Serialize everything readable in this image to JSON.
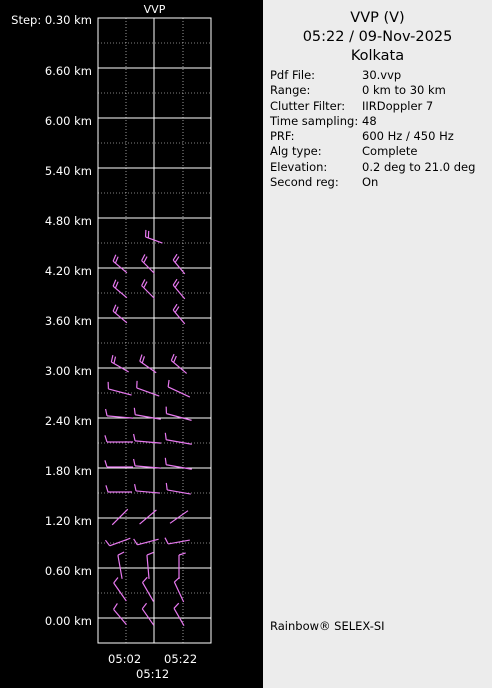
{
  "plot": {
    "title": "VVP",
    "y_labels": [
      "Step: 0.30 km",
      "6.60 km",
      "6.00 km",
      "5.40 km",
      "4.80 km",
      "4.20 km",
      "3.60 km",
      "3.00 km",
      "2.40 km",
      "1.80 km",
      "1.20 km",
      "0.60 km",
      "0.00 km"
    ],
    "x_labels": [
      "05:02",
      "05:22",
      "05:12"
    ]
  },
  "header": {
    "line1": "VVP (V)",
    "line2": "05:22 / 09-Nov-2025",
    "line3": "Kolkata"
  },
  "info": [
    {
      "key": "Pdf File:",
      "value": "30.vvp"
    },
    {
      "key": "Range:",
      "value": "0 km to 30 km"
    },
    {
      "key": "Clutter Filter:",
      "value": "IIRDoppler 7"
    },
    {
      "key": "Time sampling:",
      "value": "48"
    },
    {
      "key": "PRF:",
      "value": "600 Hz / 450 Hz"
    },
    {
      "key": "Alg type:",
      "value": "Complete"
    },
    {
      "key": "Elevation:",
      "value": "0.2 deg to 21.0 deg"
    },
    {
      "key": "Second reg:",
      "value": "On"
    }
  ],
  "footer": "Rainbow® SELEX-SI",
  "colors": {
    "barb": "#e879f0",
    "grid": "#ffffff",
    "panel": "#ececec"
  }
}
